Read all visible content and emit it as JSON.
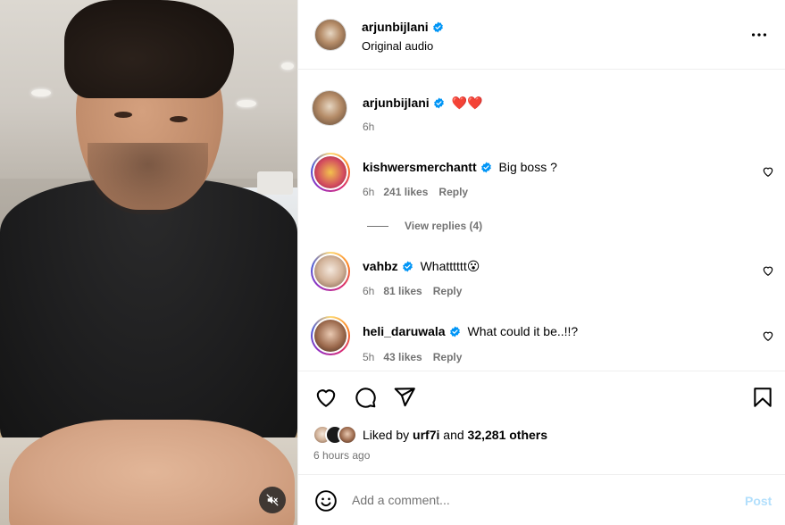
{
  "header": {
    "username": "arjunbijlani",
    "subtitle": "Original audio"
  },
  "caption": {
    "username": "arjunbijlani",
    "emoji": "❤️❤️",
    "time": "6h"
  },
  "comments": [
    {
      "username": "kishwersmerchantt",
      "text": "Big boss ?",
      "time": "6h",
      "likes": "241 likes",
      "reply": "Reply"
    },
    {
      "username": "vahbz",
      "text": "Whatttttt😮",
      "time": "6h",
      "likes": "81 likes",
      "reply": "Reply"
    },
    {
      "username": "heli_daruwala",
      "text": "What could it be..!!?",
      "time": "5h",
      "likes": "43 likes",
      "reply": "Reply"
    }
  ],
  "view_replies": "View replies (4)",
  "likes": {
    "prefix": "Liked by",
    "user": "urf7i",
    "joiner": "and",
    "others": "32,281 others"
  },
  "posted": "6 hours ago",
  "add_comment": {
    "placeholder": "Add a comment...",
    "post_label": "Post"
  },
  "colors": {
    "verified": "#0095f6",
    "muted_text": "#737373",
    "post_disabled": "#b2dffc"
  },
  "icons": [
    "verified-badge-icon",
    "more-options-icon",
    "heart-icon",
    "comment-icon",
    "share-icon",
    "save-icon",
    "emoji-icon",
    "mute-icon"
  ]
}
